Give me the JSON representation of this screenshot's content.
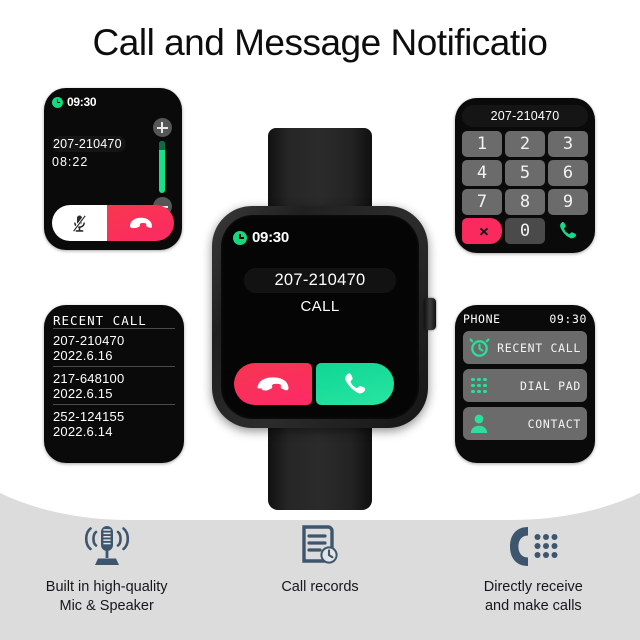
{
  "page": {
    "title": "Call and Message Notificatio",
    "background": "#ffffff",
    "band_color": "#dcdcdc"
  },
  "colors": {
    "accent_green": "#16d97f",
    "accent_red": "#fb2a5e",
    "screen_black": "#050505",
    "key_gray": "#6b6b6b",
    "icon_slate": "#3d566e"
  },
  "in_call_card": {
    "status_time": "09:30",
    "clock_icon": "clock-icon",
    "number": "207-210470",
    "duration": "08:22",
    "volume_up_icon": "plus-icon",
    "volume_down_icon": "minus-icon",
    "mute_icon": "mic-muted-icon",
    "hangup_icon": "phone-hangup-icon"
  },
  "dial_pad_card": {
    "display": "207-210470",
    "keys": [
      "1",
      "2",
      "3",
      "4",
      "5",
      "6",
      "7",
      "8",
      "9"
    ],
    "zero_key": "0",
    "backspace_icon": "backspace-delete-icon",
    "call_icon": "phone-call-icon"
  },
  "recent_call_card": {
    "title": "RECENT CALL",
    "entries": [
      {
        "number": "207-210470",
        "date": "2022.6.16"
      },
      {
        "number": "217-648100",
        "date": "2022.6.15"
      },
      {
        "number": "252-124155",
        "date": "2022.6.14"
      }
    ]
  },
  "phone_menu_card": {
    "header_title": "PHONE",
    "header_time": "09:30",
    "rows": [
      {
        "label": "RECENT CALL",
        "icon": "alarm-clock-icon"
      },
      {
        "label": "DIAL PAD",
        "icon": "keypad-dots-icon"
      },
      {
        "label": "CONTACT",
        "icon": "person-icon"
      }
    ]
  },
  "main_watch": {
    "status_time": "09:30",
    "clock_icon": "clock-icon",
    "number": "207-210470",
    "call_label": "CALL",
    "decline_icon": "phone-hangup-icon",
    "accept_icon": "phone-call-icon",
    "crown_name": "crown-button"
  },
  "features": [
    {
      "icon": "microphone-sound-waves-icon",
      "line1": "Built in high-quality",
      "line2": "Mic & Speaker"
    },
    {
      "icon": "call-records-document-clock-icon",
      "line1": "Call records",
      "line2": ""
    },
    {
      "icon": "handset-keypad-icon",
      "line1": "Directly receive",
      "line2": "and make calls"
    }
  ]
}
